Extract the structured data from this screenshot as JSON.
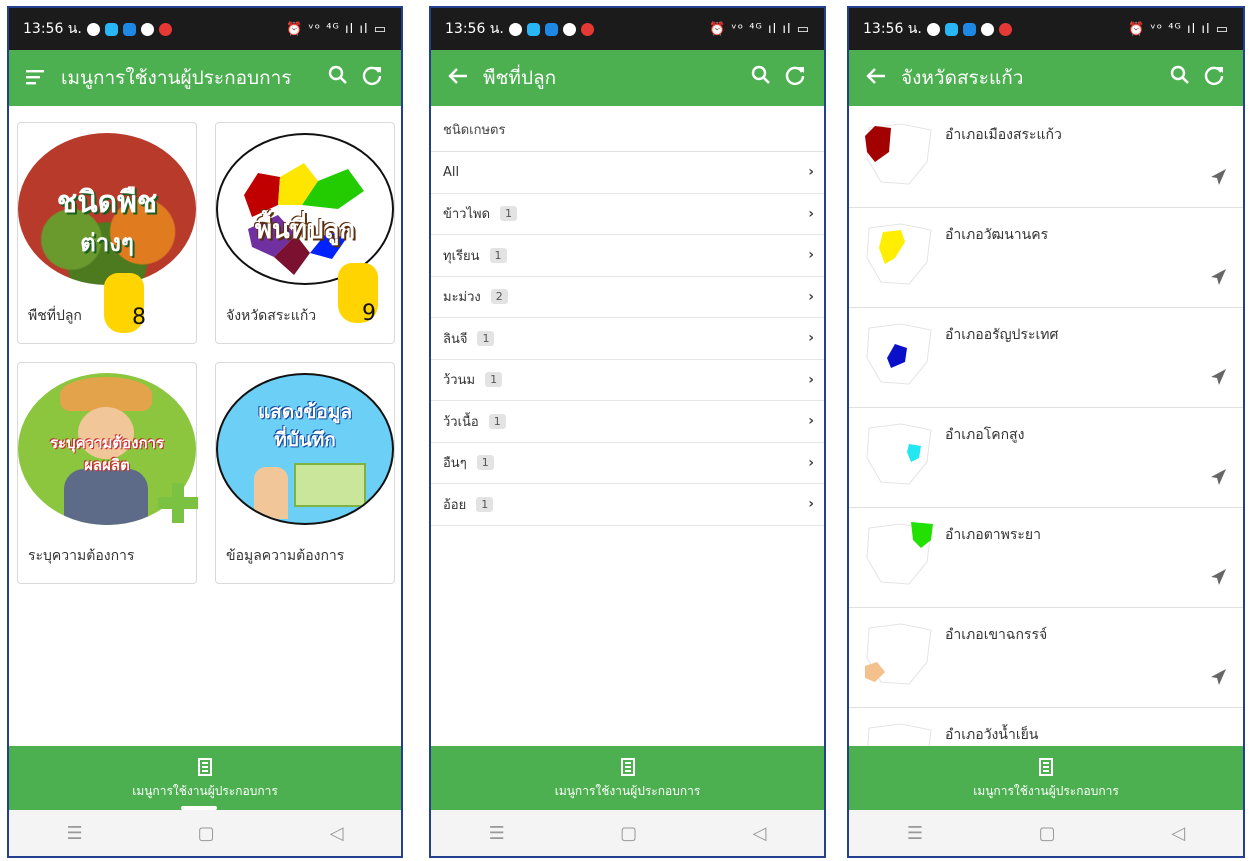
{
  "status": {
    "time": "13:56 น.",
    "right": "⏰ ᵛᵒ ⁴ᴳ ıl ıl ▭"
  },
  "panel1": {
    "title": "เมนูการใช้งานผู้ประกอบการ",
    "cards": [
      {
        "label": "พืชที่ปลูก",
        "circle_text_1": "ชนิดพืช",
        "circle_text_2": "ต่างๆ",
        "hand_number": "8"
      },
      {
        "label": "จังหวัดสระแก้ว",
        "circle_text_1": "พื้นที่ปลูก",
        "hand_number": "9"
      },
      {
        "label": "ระบุความต้องการ",
        "circle_text_1": "ระบุความต้องการ",
        "circle_text_2": "ผลผลิต"
      },
      {
        "label": "ข้อมูลความต้องการ",
        "circle_text_1": "แสดงข้อมูล",
        "circle_text_2": "ที่บันทึก"
      }
    ],
    "bottom_label": "เมนูการใช้งานผู้ประกอบการ"
  },
  "panel2": {
    "title": "พืชที่ปลูก",
    "section_header": "ชนิดเกษตร",
    "rows": [
      {
        "name": "All",
        "count": ""
      },
      {
        "name": "ข้าวไพด",
        "count": "1"
      },
      {
        "name": "ทุเรียน",
        "count": "1"
      },
      {
        "name": "มะม่วง",
        "count": "2"
      },
      {
        "name": "ลินจี",
        "count": "1"
      },
      {
        "name": "ว้วนม",
        "count": "1"
      },
      {
        "name": "ว้วเนื้อ",
        "count": "1"
      },
      {
        "name": "อืนๆ",
        "count": "1"
      },
      {
        "name": "อ้อย",
        "count": "1"
      }
    ],
    "bottom_label": "เมนูการใช้งานผู้ประกอบการ"
  },
  "panel3": {
    "title": "จังหวัดสระแก้ว",
    "districts": [
      {
        "name": "อำเภอเมืองสระแก้ว",
        "color": "#a30000"
      },
      {
        "name": "อำเภอวัฒนานคร",
        "color": "#ffee00"
      },
      {
        "name": "อำเภออรัญประเทศ",
        "color": "#0a10c8"
      },
      {
        "name": "อำเภอโคกสูง",
        "color": "#22e6f0"
      },
      {
        "name": "อำเภอตาพระยา",
        "color": "#22e000"
      },
      {
        "name": "อำเภอเขาฉกรรจ์",
        "color": "#f4c08c"
      },
      {
        "name": "อำเภอวังน้ำเย็น",
        "color": "#cccccc"
      }
    ],
    "bottom_label": "เมนูการใช้งานผู้ประกอบการ"
  },
  "colors": {
    "appbar": "#4caf50",
    "border": "#23408e"
  }
}
